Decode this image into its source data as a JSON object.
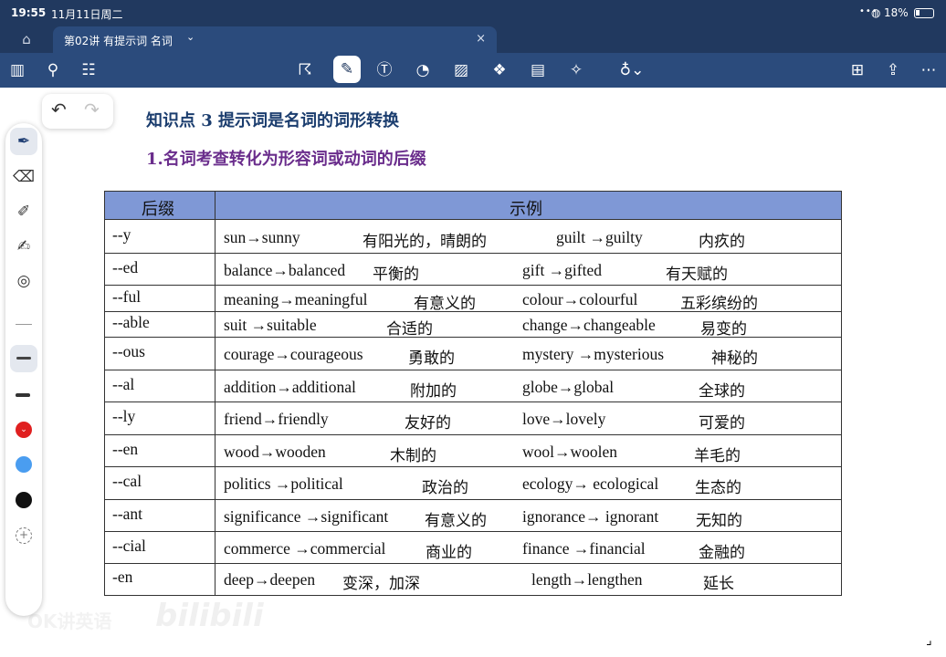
{
  "status": {
    "time": "19:55",
    "date": "11月11日周二",
    "battery": "18%"
  },
  "tab": {
    "title": "第02讲 有提示词 名词"
  },
  "doc": {
    "heading1": "知识点 3  提示词是名词的词形转换",
    "heading2": "1.名词考查转化为形容词或动词的后缀",
    "table": {
      "headers": [
        "后缀",
        "示例"
      ],
      "rows": [
        {
          "suffix": "--y",
          "ex1": "sun→sunny",
          "m1": "有阳光的，晴朗的",
          "ex2": "guilt →guilty",
          "m2": "内疚的"
        },
        {
          "suffix": "--ed",
          "ex1": "balance→balanced",
          "m1": "平衡的",
          "ex2": "gift →gifted",
          "m2": "有天赋的"
        },
        {
          "suffix": "--ful",
          "ex1": "meaning→meaningful",
          "m1": "有意义的",
          "ex2": "colour→colourful",
          "m2": "五彩缤纷的"
        },
        {
          "suffix": "--able",
          "ex1": "suit  →suitable",
          "m1": "合适的",
          "ex2": "change→changeable",
          "m2": "易变的"
        },
        {
          "suffix": "--ous",
          "ex1": "courage→courageous",
          "m1": "勇敢的",
          "ex2": "mystery →mysterious",
          "m2": "神秘的"
        },
        {
          "suffix": "--al",
          "ex1": "addition→additional",
          "m1": "附加的",
          "ex2": "globe→global",
          "m2": "全球的"
        },
        {
          "suffix": "--ly",
          "ex1": "friend→friendly",
          "m1": "友好的",
          "ex2": "love→lovely",
          "m2": "可爱的"
        },
        {
          "suffix": "--en",
          "ex1": "wood→wooden",
          "m1": "木制的",
          "ex2": "wool→woolen",
          "m2": "羊毛的"
        },
        {
          "suffix": "--cal",
          "ex1": "politics →political",
          "m1": "政治的",
          "ex2": "ecology→ ecological",
          "m2": "生态的"
        },
        {
          "suffix": "--ant",
          "ex1": "significance →significant",
          "m1": "有意义的",
          "ex2": "ignorance→ ignorant",
          "m2": "无知的"
        },
        {
          "suffix": "--cial",
          "ex1": "commerce →commercial",
          "m1": "商业的",
          "ex2": "finance →financial",
          "m2": "金融的"
        },
        {
          "suffix": "-en",
          "ex1": "deep→deepen",
          "m1": "变深，加深",
          "ex2": "length→lengthen",
          "m2": "延长"
        }
      ]
    }
  },
  "watermark": {
    "text": "OK讲英语",
    "logo": "bilibili"
  },
  "colors": {
    "topbar": "#21395f",
    "toolbar": "#2b4b7c",
    "table_header": "#7f98d6",
    "heading1": "#1b3d6e",
    "heading2": "#6a2d8c",
    "pen_red": "#e02020",
    "pen_blue": "#4a9df0",
    "pen_black": "#111111"
  },
  "icons": {
    "toolbar_left": [
      "sidebar-icon",
      "search-icon",
      "document-list-icon"
    ],
    "toolbar_center": [
      "lasso-icon",
      "pen-icon",
      "text-box-icon",
      "shapes-icon",
      "image-icon",
      "elements-icon",
      "sticky-note-icon",
      "laser-pointer-icon",
      "microphone-icon"
    ],
    "toolbar_right": [
      "add-page-icon",
      "share-icon",
      "more-icon"
    ]
  }
}
